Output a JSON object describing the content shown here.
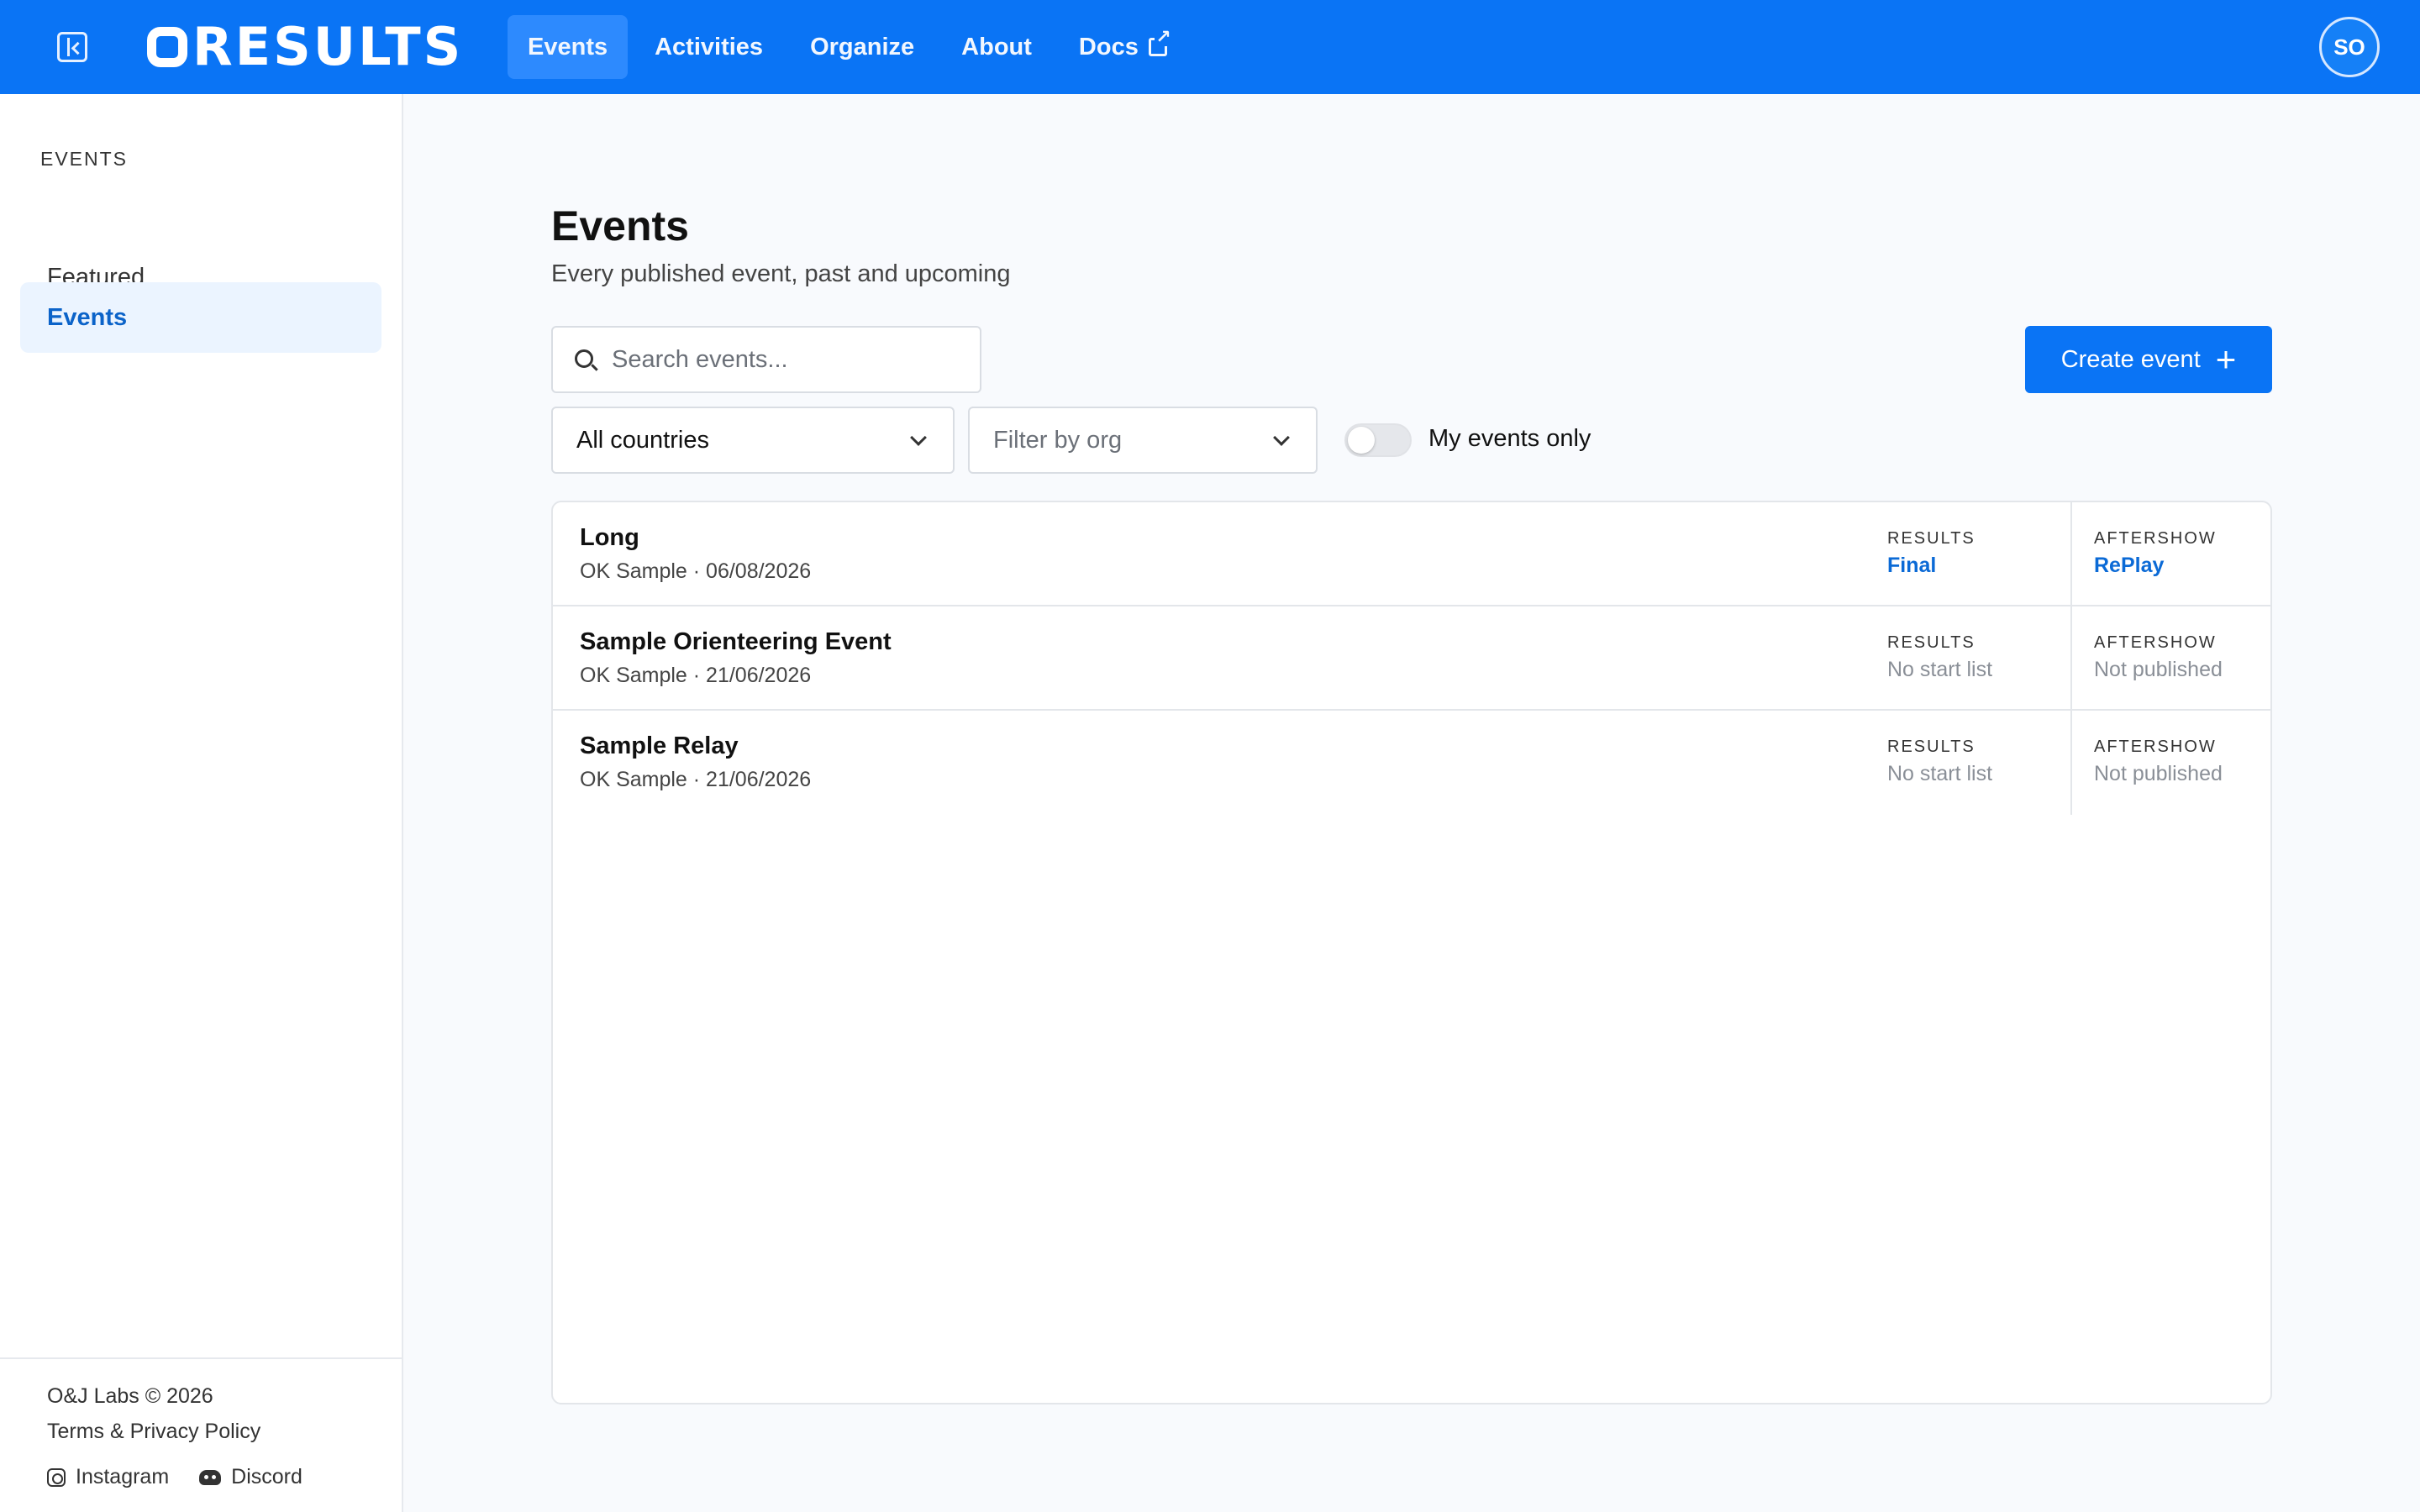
{
  "header": {
    "logo_text": "RESULTS",
    "nav": [
      {
        "label": "Events",
        "active": true
      },
      {
        "label": "Activities",
        "active": false
      },
      {
        "label": "Organize",
        "active": false
      },
      {
        "label": "About",
        "active": false
      },
      {
        "label": "Docs",
        "active": false,
        "external": true
      }
    ],
    "avatar_initials": "SO"
  },
  "sidebar": {
    "heading": "EVENTS",
    "items": [
      {
        "label": "Featured",
        "active": false
      },
      {
        "label": "Events",
        "active": true
      }
    ],
    "footer": {
      "copyright": "O&J Labs © 2026",
      "terms": "Terms & Privacy Policy",
      "instagram": "Instagram",
      "discord": "Discord"
    }
  },
  "main": {
    "title": "Events",
    "subtitle": "Every published event, past and upcoming",
    "search_placeholder": "Search events...",
    "create_label": "Create event",
    "country_filter": "All countries",
    "org_filter_placeholder": "Filter by org",
    "my_events_label": "My events only",
    "my_events_on": false,
    "events": [
      {
        "name": "Long",
        "meta": "OK Sample · 06/08/2026",
        "results_label": "RESULTS",
        "results_value": "Final",
        "results_link": true,
        "aftershow_label": "AFTERSHOW",
        "aftershow_value": "RePlay",
        "aftershow_link": true
      },
      {
        "name": "Sample Orienteering Event",
        "meta": "OK Sample · 21/06/2026",
        "results_label": "RESULTS",
        "results_value": "No start list",
        "results_link": false,
        "aftershow_label": "AFTERSHOW",
        "aftershow_value": "Not published",
        "aftershow_link": false
      },
      {
        "name": "Sample Relay",
        "meta": "OK Sample · 21/06/2026",
        "results_label": "RESULTS",
        "results_value": "No start list",
        "results_link": false,
        "aftershow_label": "AFTERSHOW",
        "aftershow_value": "Not published",
        "aftershow_link": false
      }
    ]
  },
  "colors": {
    "brand": "#0a74f5",
    "link": "#0b6ad6",
    "active_bg": "#ebf4ff"
  }
}
